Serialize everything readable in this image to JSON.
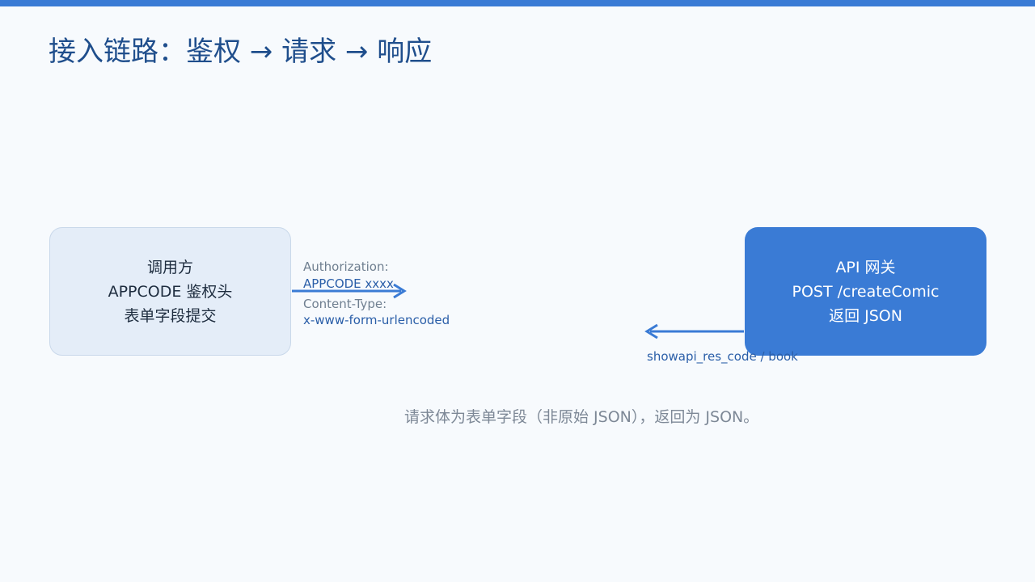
{
  "header": {
    "accent_color": "#3a7bd5",
    "title": "接入链路：鉴权 → 请求 → 响应"
  },
  "diagram": {
    "caller": {
      "lines": [
        "调用方",
        "APPCODE 鉴权头",
        "表单字段提交"
      ],
      "fill_color": "#e4edf8"
    },
    "gateway": {
      "lines": [
        "API 网关",
        "POST /createComic",
        "返回 JSON"
      ],
      "fill_color": "#3a7bd5"
    },
    "request_labels": {
      "auth_key": "Authorization:",
      "auth_value": "APPCODE xxxx",
      "content_type_key": "Content-Type:",
      "content_type_value": "x-www-form-urlencoded"
    },
    "response_label": "showapi_res_code / book",
    "arrow_color": "#3a7bd5"
  },
  "footer": {
    "caption": "请求体为表单字段（非原始 JSON），返回为 JSON。"
  }
}
